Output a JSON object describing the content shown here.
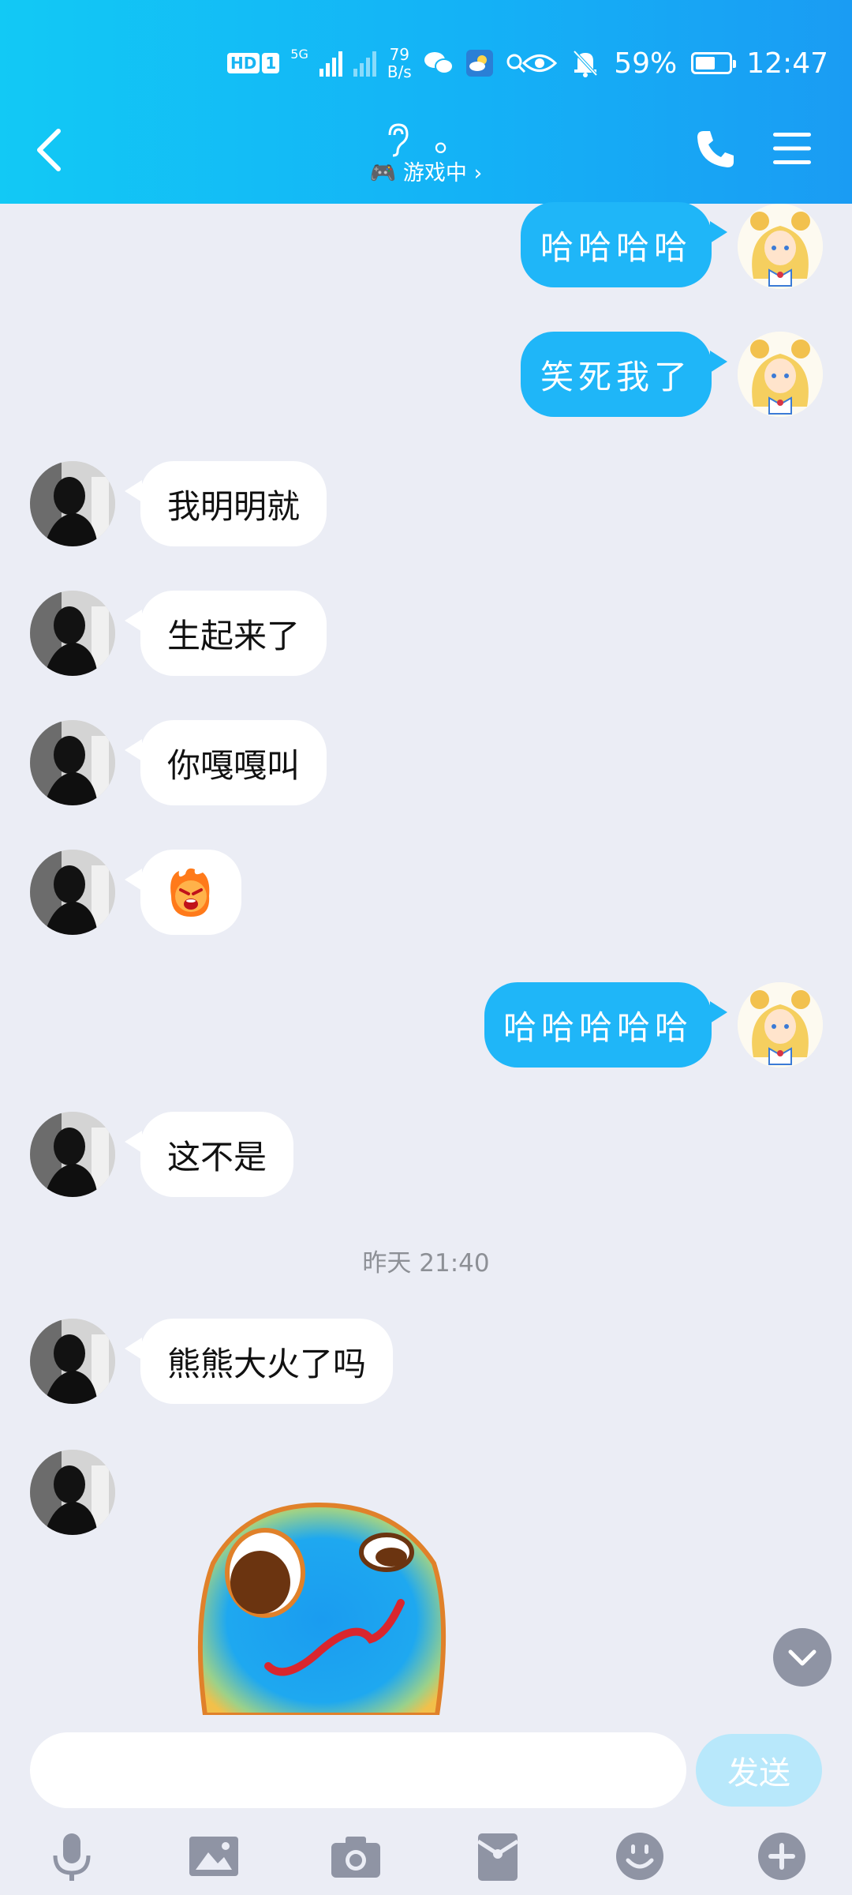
{
  "status_bar": {
    "hd_badge": "HD",
    "sim_badge": "1",
    "network": "5G",
    "speed_value": "79",
    "speed_unit": "B/s",
    "battery": "59%",
    "battery_level": 0.59,
    "time": "12:47"
  },
  "header": {
    "name": "。",
    "status": "🎮 游戏中 ›"
  },
  "messages": [
    {
      "side": "me",
      "text": "哈哈哈哈"
    },
    {
      "side": "me",
      "text": "笑死我了"
    },
    {
      "side": "other",
      "text": "我明明就"
    },
    {
      "side": "other",
      "text": "生起来了"
    },
    {
      "side": "other",
      "text": "你嘎嘎叫"
    },
    {
      "side": "other",
      "sticker": "angry-fire-emoji"
    },
    {
      "side": "me",
      "text": "哈哈哈哈哈"
    },
    {
      "side": "other",
      "text": "这不是"
    },
    {
      "side": "other",
      "text": "熊熊大火了吗"
    },
    {
      "side": "other",
      "sticker": "silly-face-sticker"
    }
  ],
  "timestamp": "昨天 21:40",
  "composer": {
    "placeholder": "",
    "send_label": "发送"
  },
  "toolbar": [
    "microphone-icon",
    "image-icon",
    "camera-icon",
    "red-packet-icon",
    "emoji-icon",
    "plus-icon"
  ],
  "colors": {
    "header_start": "#12c9f5",
    "header_end": "#1a9cf3",
    "my_bubble": "#1fb6f8",
    "background": "#ebedf5",
    "send_button": "#b8e8fb"
  }
}
